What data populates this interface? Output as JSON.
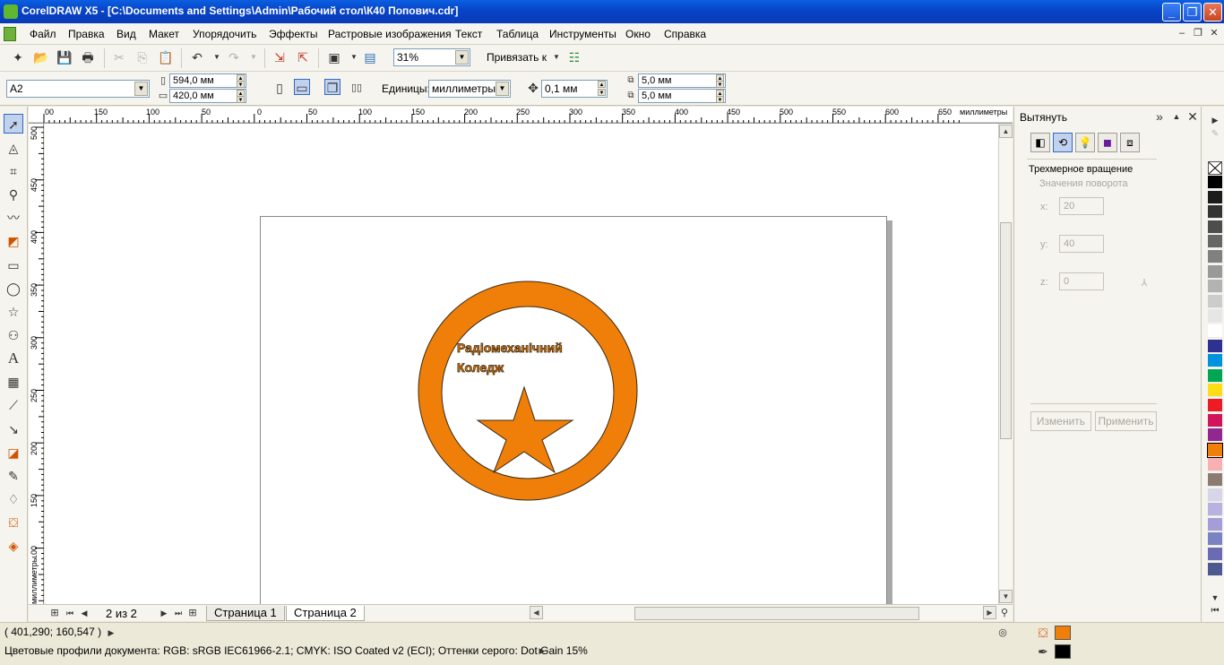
{
  "window": {
    "title": "CorelDRAW X5 - [C:\\Documents and Settings\\Admin\\Рабочий стол\\К40 Попович.cdr]"
  },
  "menu": {
    "items": [
      "Файл",
      "Правка",
      "Вид",
      "Макет",
      "Упорядочить",
      "Эффекты",
      "Растровые изображения",
      "Текст",
      "Таблица",
      "Инструменты",
      "Окно",
      "Справка"
    ]
  },
  "toolbar": {
    "zoom": "31%",
    "snap_label": "Привязать к"
  },
  "property_bar": {
    "paper_size": "A2",
    "width": "594,0 мм",
    "height": "420,0 мм",
    "units_label": "Единицы:",
    "units_value": "миллиметры",
    "nudge": "0,1 мм",
    "dup_x": "5,0 мм",
    "dup_y": "5,0 мм"
  },
  "ruler": {
    "h_labels": [
      "00",
      "150",
      "100",
      "50",
      "0",
      "50",
      "100",
      "150",
      "200",
      "250",
      "300",
      "350",
      "400",
      "450",
      "500",
      "550",
      "600",
      "650"
    ],
    "h_unit": "миллиметры",
    "v_labels": [
      "500",
      "450",
      "400",
      "350",
      "300",
      "250",
      "200",
      "150",
      "100",
      "50"
    ],
    "v_unit": "миллиметры"
  },
  "artwork": {
    "line1": "Радіомеханічний",
    "line2": "Коледж",
    "fill": "#f07f09",
    "stroke": "#3a2a10"
  },
  "pages": {
    "counter": "2 из 2",
    "tabs": [
      "Страница 1",
      "Страница 2"
    ],
    "active": 1
  },
  "docker": {
    "title": "Вытянуть",
    "section": "Трехмерное вращение",
    "subsection": "Значения поворота",
    "x_label": "x:",
    "x_value": "20",
    "y_label": "y:",
    "y_value": "40",
    "z_label": "z:",
    "z_value": "0",
    "edit_button": "Изменить",
    "apply_button": "Применить"
  },
  "palette": [
    "#ffffff",
    "#000000",
    "#1c1c1c",
    "#333333",
    "#4d4d4d",
    "#666666",
    "#808080",
    "#999999",
    "#b3b3b3",
    "#cccccc",
    "#e6e6e6",
    "#ffffff",
    "#2e3192",
    "#0093dd",
    "#00a651",
    "#ffde17",
    "#ed1c24",
    "#d2145a",
    "#92278f",
    "#f07f09",
    "#f9b0b3",
    "#8c7b70",
    "#d9d5e9",
    "#b7b2e0",
    "#a39ed9",
    "#7983c1",
    "#6b6bb3",
    "#4c5a8f"
  ],
  "status": {
    "coords": "( 401,290; 160,547 )",
    "profiles": "Цветовые профили документа: RGB: sRGB IEC61966-2.1; CMYK: ISO Coated v2 (ECI); Оттенки серого: Dot Gain 15%",
    "fill_color": "#f07f09",
    "outline_color": "#000000"
  }
}
